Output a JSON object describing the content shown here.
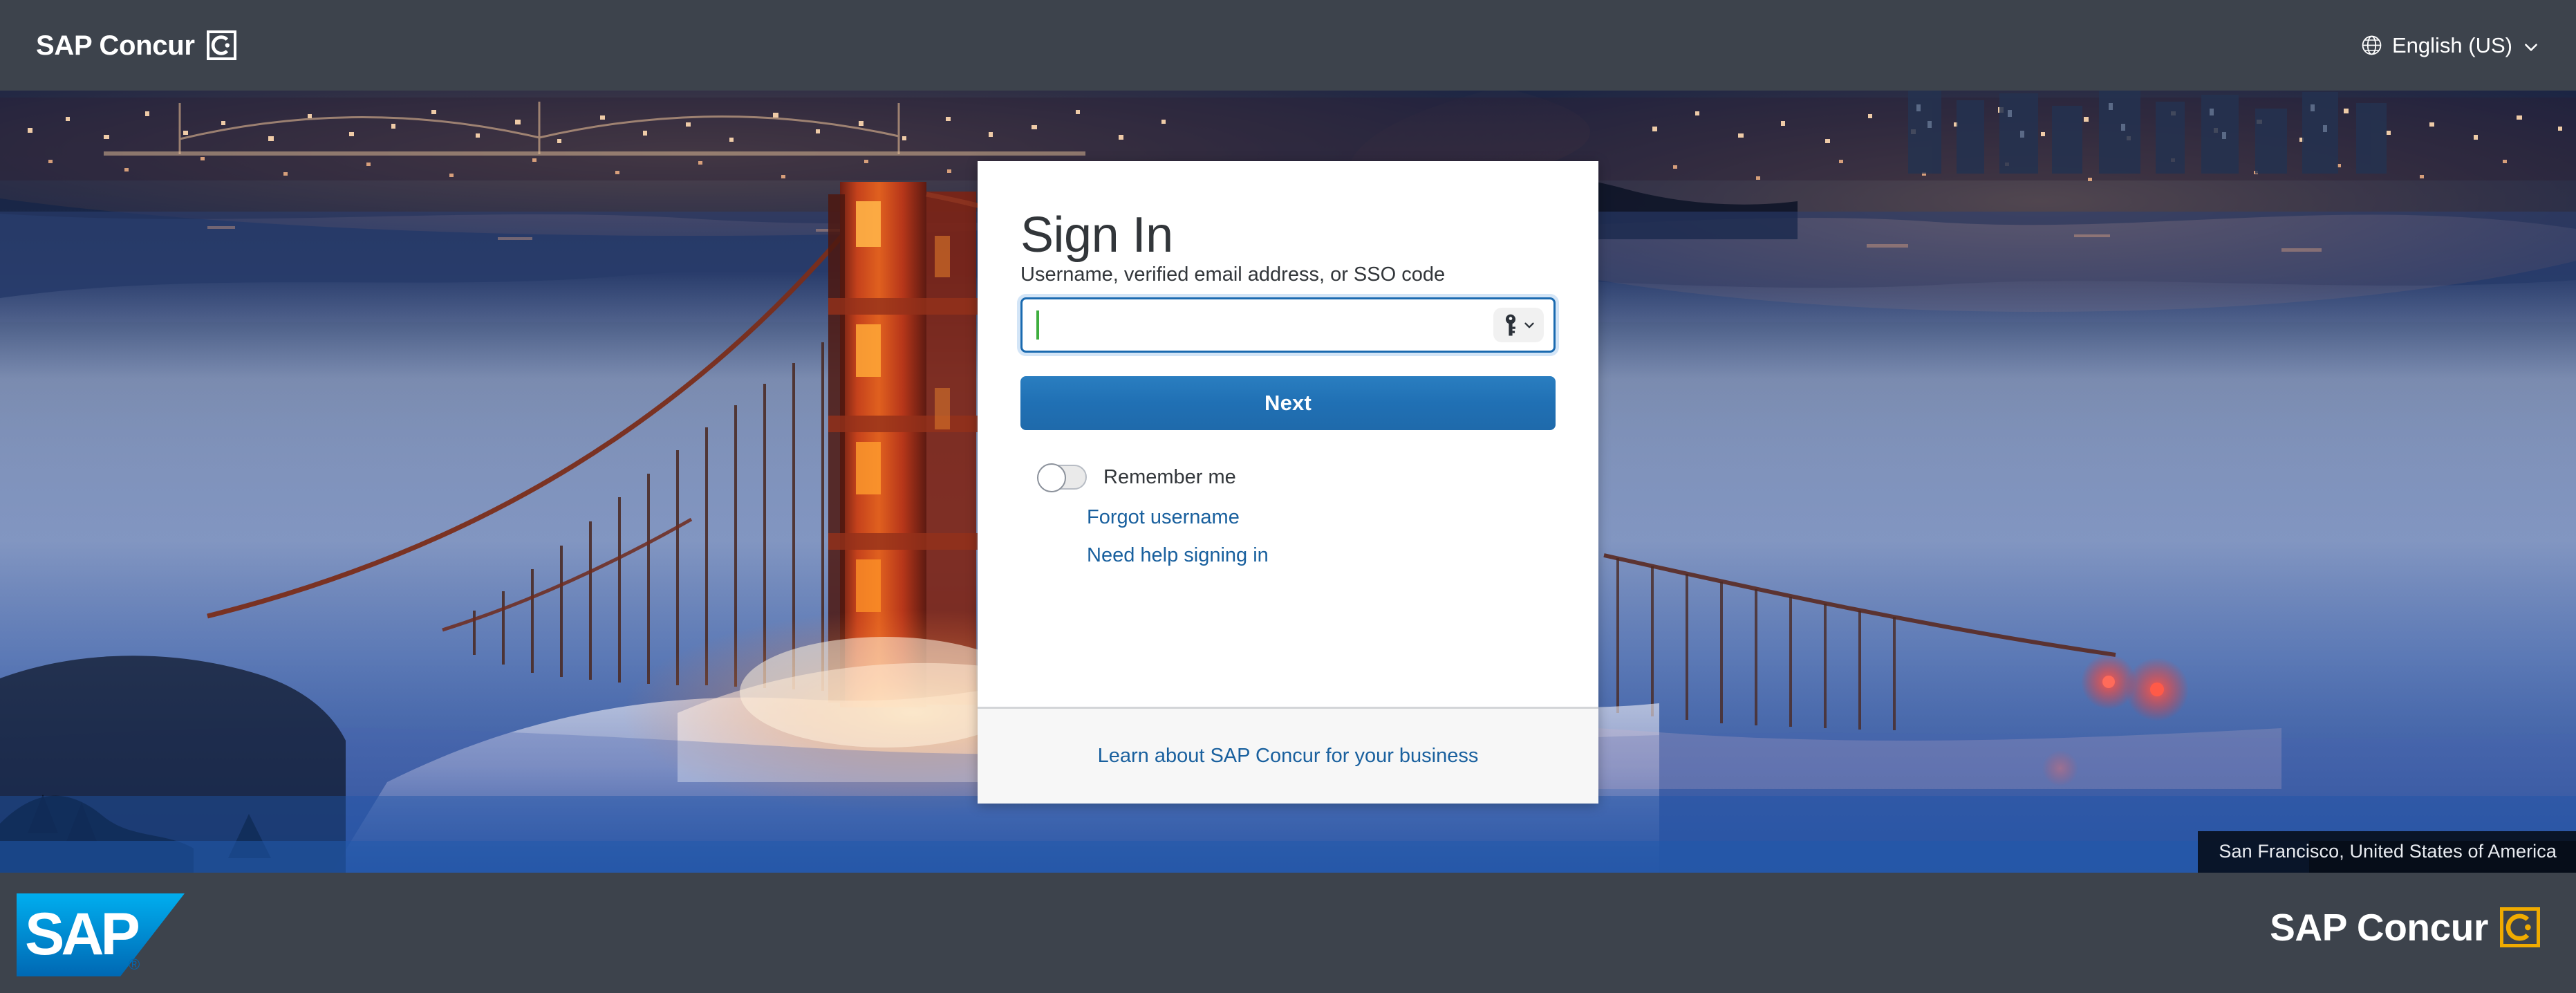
{
  "header": {
    "brand_name": "SAP Concur",
    "brand_mark_icon": "concur-c-dot-icon",
    "language": {
      "globe_icon": "globe-icon",
      "label": "English (US)",
      "chevron_icon": "chevron-down-icon"
    }
  },
  "hero": {
    "scene_description": "Golden Gate Bridge tower above fog at dusk with San Francisco skyline",
    "photo_credit": "San Francisco, United States of America"
  },
  "card": {
    "title": "Sign In",
    "username_label": "Username, verified email address, or SSO code",
    "username_value": "",
    "username_placeholder": "",
    "password_manager_icon": "key-icon",
    "password_manager_chevron_icon": "chevron-down-icon",
    "next_label": "Next",
    "remember_me_label": "Remember me",
    "remember_me_state": "off",
    "forgot_username_label": "Forgot username",
    "need_help_label": "Need help signing in",
    "footer_link_label": "Learn about SAP Concur for your business"
  },
  "footer": {
    "sap_logo_text": "SAP",
    "sap_logo_registered": "®",
    "concur_brand_name": "SAP Concur",
    "concur_mark_icon": "concur-c-dot-icon"
  },
  "colors": {
    "bar_background": "#3d434c",
    "primary_button": "#2070b4",
    "link": "#19609e",
    "accent_orange": "#f0ab00",
    "sap_blue": "#0a6ebd",
    "focus_border": "#1a6ab0",
    "caret_green": "#3fae3f"
  }
}
